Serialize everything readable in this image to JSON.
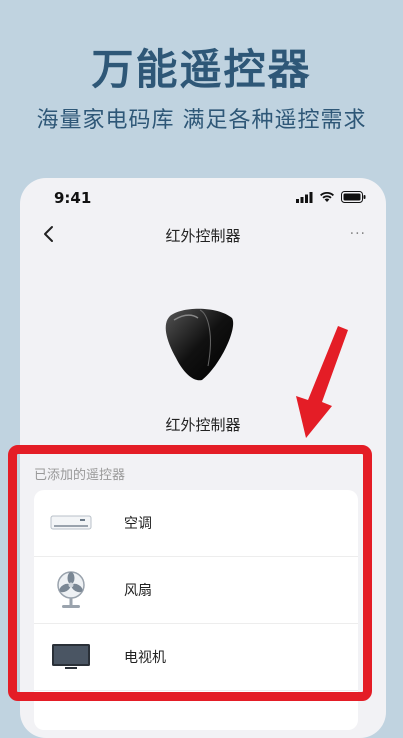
{
  "promo": {
    "title": "万能遥控器",
    "subtitle": "海量家电码库 满足各种遥控需求"
  },
  "status_bar": {
    "time": "9:41"
  },
  "nav": {
    "title": "红外控制器",
    "more": "···"
  },
  "device": {
    "name": "红外控制器"
  },
  "remotes": {
    "section_title": "已添加的遥控器",
    "items": [
      {
        "label": "空调",
        "icon": "air-conditioner-icon"
      },
      {
        "label": "风扇",
        "icon": "fan-icon"
      },
      {
        "label": "电视机",
        "icon": "tv-icon"
      }
    ]
  },
  "colors": {
    "background": "#c0d3e0",
    "headline": "#2e5777",
    "highlight": "#e41d26"
  }
}
